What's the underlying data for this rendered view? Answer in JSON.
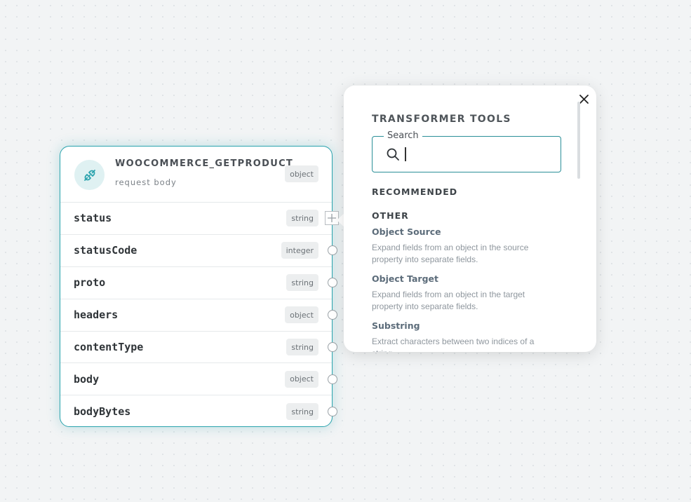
{
  "node": {
    "title": "WOOCOMMERCE_GETPRODUCT",
    "subtitle": "request body",
    "type_badge": "object",
    "icon": "plug-icon",
    "accent_color": "#2ba3ad",
    "fields": [
      {
        "name": "status",
        "type": "string"
      },
      {
        "name": "statusCode",
        "type": "integer"
      },
      {
        "name": "proto",
        "type": "string"
      },
      {
        "name": "headers",
        "type": "object"
      },
      {
        "name": "contentType",
        "type": "string"
      },
      {
        "name": "body",
        "type": "object"
      },
      {
        "name": "bodyBytes",
        "type": "string"
      }
    ]
  },
  "popover": {
    "title": "TRANSFORMER TOOLS",
    "search": {
      "label": "Search",
      "value": "",
      "placeholder": ""
    },
    "recommended_label": "RECOMMENDED",
    "other_label": "OTHER",
    "tools": [
      {
        "name": "Object Source",
        "description": "Expand fields from an object in the source property into separate fields."
      },
      {
        "name": "Object Target",
        "description": "Expand fields from an object in the target property into separate fields."
      },
      {
        "name": "Substring",
        "description": "Extract characters between two indices of a string."
      }
    ],
    "close_icon": "close-icon"
  }
}
